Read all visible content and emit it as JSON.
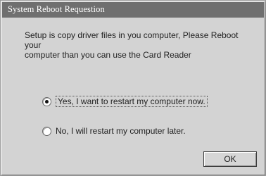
{
  "window": {
    "title": "System Reboot Requestion"
  },
  "message": {
    "line1": "Setup is copy driver files in you computer, Please Reboot your",
    "line2": "computer than you can use the Card Reader"
  },
  "options": [
    {
      "label": "Yes, I want to restart my computer now.",
      "selected": true
    },
    {
      "label": "No, I will restart my computer later.",
      "selected": false
    }
  ],
  "buttons": {
    "ok_label": "OK"
  }
}
